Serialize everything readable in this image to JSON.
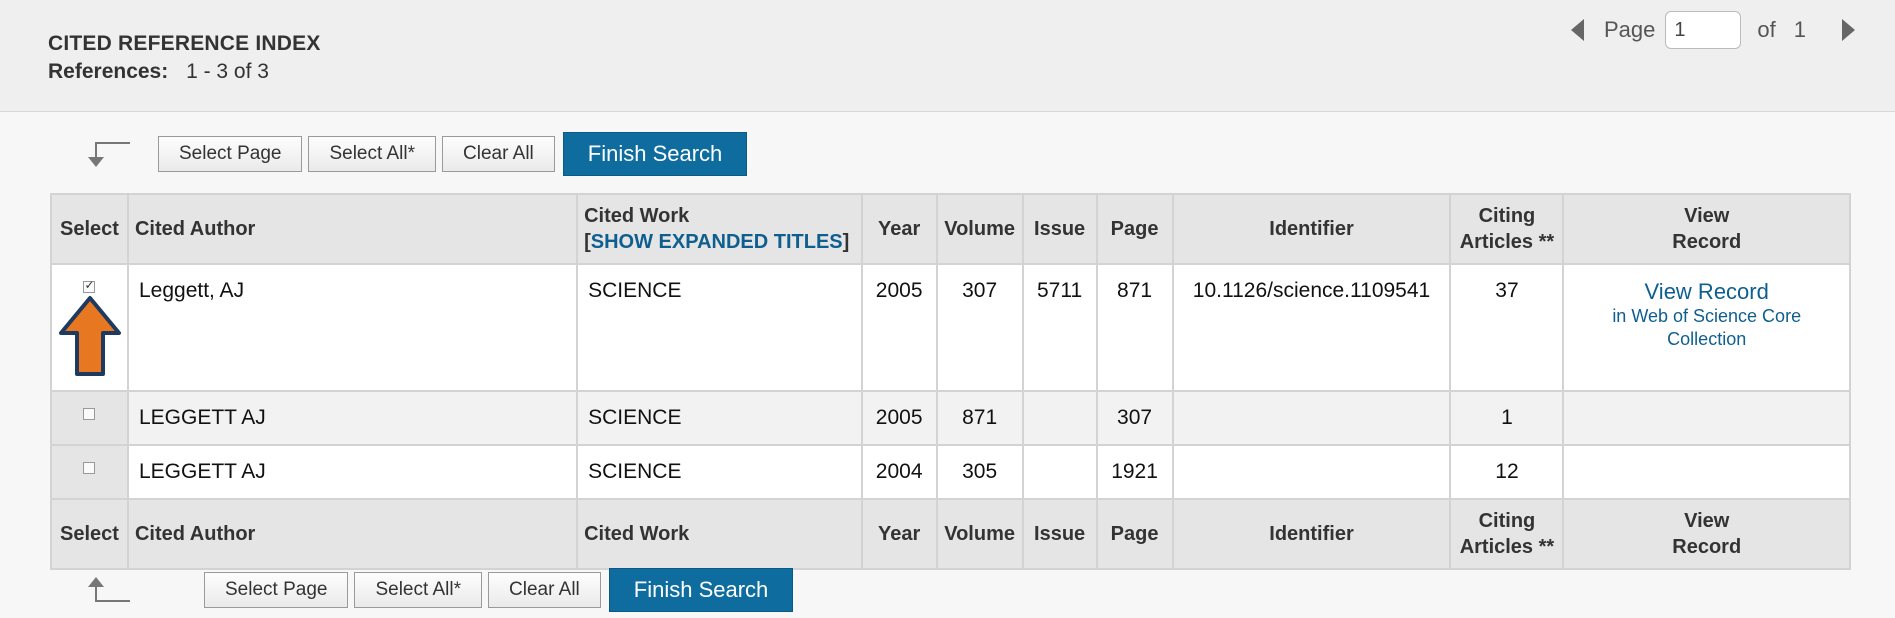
{
  "header": {
    "title": "CITED REFERENCE INDEX",
    "references_label": "References:",
    "references_value": "1 - 3 of 3"
  },
  "pager": {
    "page_label": "Page",
    "page_value": "1",
    "of_label": "of",
    "total_pages": "1"
  },
  "actions": {
    "select_page": "Select Page",
    "select_all": "Select All*",
    "clear_all": "Clear All",
    "finish_search": "Finish Search"
  },
  "table": {
    "headers": {
      "select": "Select",
      "cited_author": "Cited Author",
      "cited_work": "Cited Work",
      "show_expanded_open": "[",
      "show_expanded": "SHOW EXPANDED TITLES",
      "show_expanded_close": "]",
      "year": "Year",
      "volume": "Volume",
      "issue": "Issue",
      "page": "Page",
      "identifier": "Identifier",
      "citing_articles_1": "Citing",
      "citing_articles_2": "Articles **",
      "view_record_1": "View",
      "view_record_2": "Record"
    },
    "rows": [
      {
        "checked": true,
        "author": "Leggett, AJ",
        "work": "SCIENCE",
        "year": "2005",
        "volume": "307",
        "issue": "5711",
        "page": "871",
        "identifier": "10.1126/science.1109541",
        "citing": "37",
        "view_link": "View Record",
        "view_sub": "in Web of Science Core Collection"
      },
      {
        "checked": false,
        "author": "LEGGETT AJ",
        "work": "SCIENCE",
        "year": "2005",
        "volume": "871",
        "issue": "",
        "page": "307",
        "identifier": "",
        "citing": "1"
      },
      {
        "checked": false,
        "author": "LEGGETT AJ",
        "work": "SCIENCE",
        "year": "2004",
        "volume": "305",
        "issue": "",
        "page": "1921",
        "identifier": "",
        "citing": "12"
      }
    ]
  },
  "colors": {
    "primary_button": "#0e6d9e",
    "link": "#0e5f8f",
    "annotation_arrow": "#e87722",
    "annotation_arrow_outline": "#1f3a5f"
  },
  "icons": {
    "prev_page": "triangle-left-icon",
    "next_page": "triangle-right-icon",
    "select_arrow_top": "corner-arrow-down-icon",
    "select_arrow_bottom": "corner-arrow-up-icon",
    "annotation": "orange-up-arrow-icon"
  }
}
